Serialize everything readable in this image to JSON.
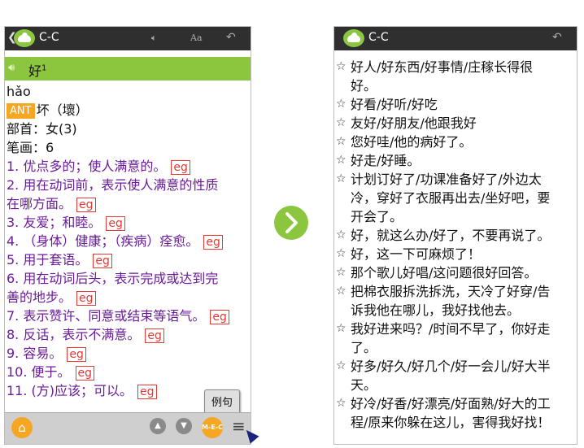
{
  "left": {
    "app_title": "C-C",
    "headword": "好",
    "headword_sup": "1",
    "pinyin": "hǎo",
    "ant_badge": "ANT",
    "antonym": "坏（壞）",
    "radical": "部首：女(3)",
    "strokes": "笔画：6",
    "senses": [
      [
        "1. 优点多的；使人满意的。"
      ],
      [
        "2. 用在动词前，表示使人满意的性质",
        "在哪方面。"
      ],
      [
        "3. 友爱；和睦。"
      ],
      [
        "4. （身体）健康；（疾病）痊愈。"
      ],
      [
        "5. 用于套语。"
      ],
      [
        "6. 用在动词后头，表示完成或达到完",
        "善的地步。"
      ],
      [
        "7. 表示赞许、同意或结束等语气。"
      ],
      [
        "8. 反话，表示不满意。"
      ],
      [
        "9. 容易。"
      ],
      [
        "10. 便于。"
      ],
      [
        "11. (方)应该；可以。"
      ]
    ],
    "eg_label": "eg",
    "popup_label": "例句",
    "mec_label": "M-E-C"
  },
  "right": {
    "app_title": "C-C",
    "examples": [
      [
        "好人/好东西/好事情/庄稼长得很",
        "好。"
      ],
      [
        "好看/好听/好吃"
      ],
      [
        "友好/好朋友/他跟我好"
      ],
      [
        "您好哇/他的病好了。"
      ],
      [
        "好走/好睡。"
      ],
      [
        "计划订好了/功课准备好了/外边太",
        "冷，穿好了衣服再出去/坐好吧，要",
        "开会了。"
      ],
      [
        "好，就这么办/好了，不要再说了。"
      ],
      [
        "好，这一下可麻烦了！"
      ],
      [
        "那个歌儿好唱/这问题很好回答。"
      ],
      [
        "把棉衣服拆洗拆洗，天冷了好穿/告",
        "诉我他在哪儿，我好找他去。"
      ],
      [
        "我好进来吗？/时间不早了，你好走",
        "了。"
      ],
      [
        "好多/好久/好几个/好一会儿/好大半",
        "天。"
      ],
      [
        "好冷/好香/好漂亮/好面熟/好大的工",
        "程/原来你躲在这儿，害得我好找！"
      ]
    ]
  }
}
